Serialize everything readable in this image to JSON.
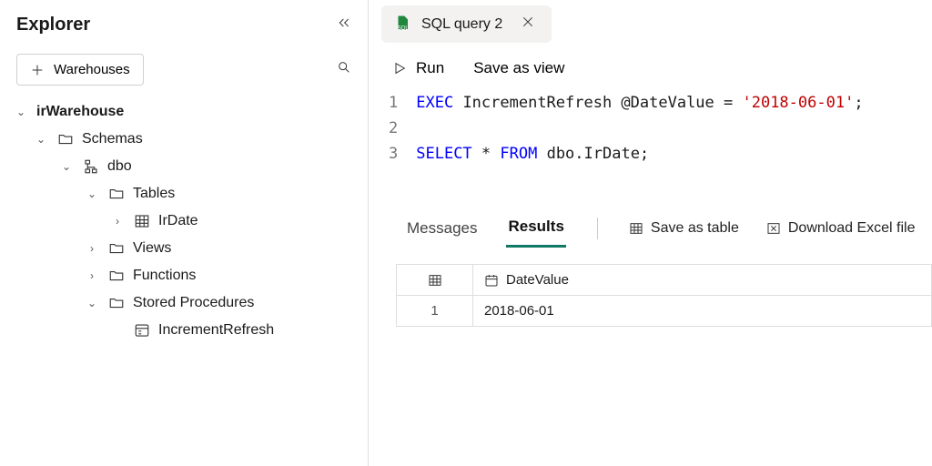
{
  "sidebar": {
    "title": "Explorer",
    "add_label": "Warehouses",
    "tree": {
      "warehouse": "irWarehouse",
      "schemas": "Schemas",
      "dbo": "dbo",
      "tables": "Tables",
      "irdate": "IrDate",
      "views": "Views",
      "functions": "Functions",
      "sprocs": "Stored Procedures",
      "incrementrefresh": "IncrementRefresh"
    }
  },
  "tab": {
    "label": "SQL query 2"
  },
  "toolbar": {
    "run": "Run",
    "save_as_view": "Save as view"
  },
  "sql": {
    "lines": {
      "l1_kw": "EXEC",
      "l1_rest": " IncrementRefresh @DateValue = ",
      "l1_str": "'2018-06-01'",
      "l1_end": ";",
      "l3_kw1": "SELECT",
      "l3_mid": " * ",
      "l3_kw2": "FROM",
      "l3_rest": " dbo.IrDate;"
    }
  },
  "results": {
    "messages_tab": "Messages",
    "results_tab": "Results",
    "save_as_table": "Save as table",
    "download_excel": "Download Excel file",
    "col1": "DateValue",
    "row1_idx": "1",
    "row1_col1": "2018-06-01"
  }
}
